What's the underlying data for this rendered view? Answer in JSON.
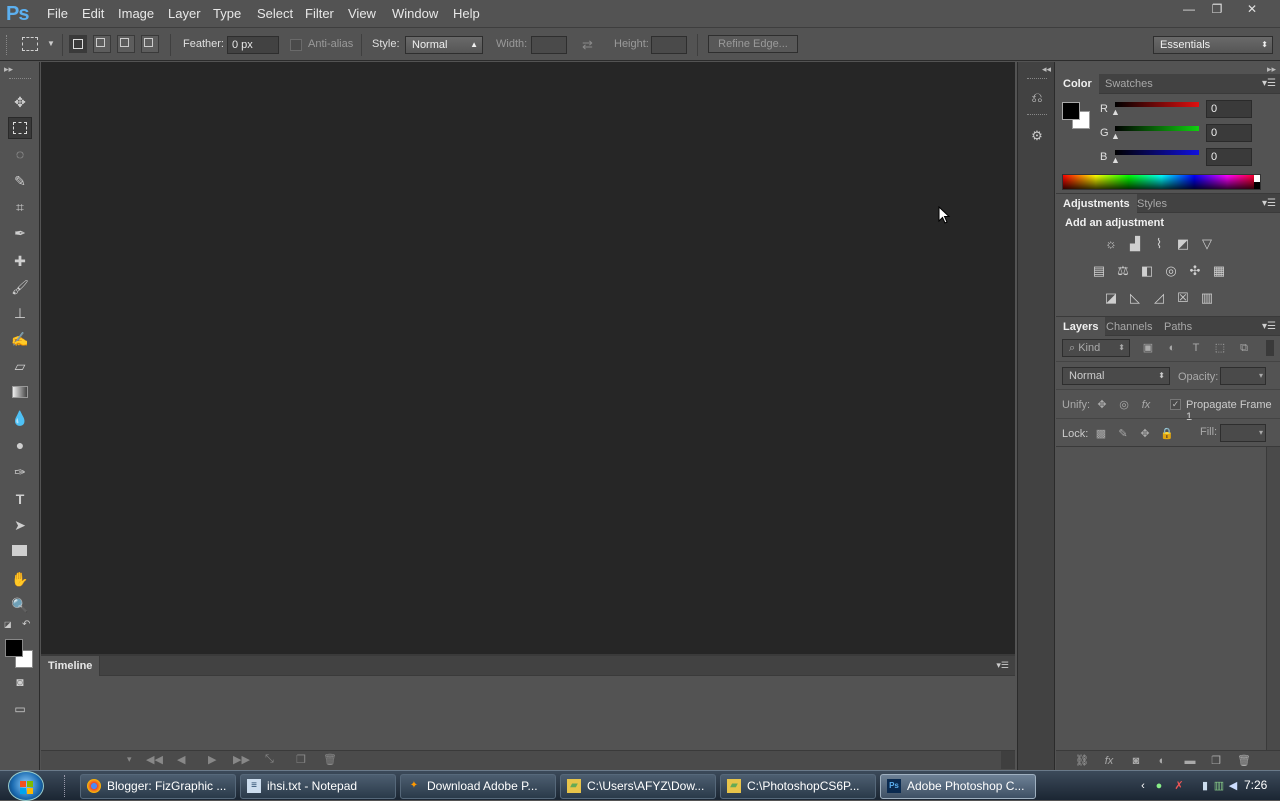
{
  "app": {
    "logo": "Ps"
  },
  "menubar": {
    "items": [
      "File",
      "Edit",
      "Image",
      "Layer",
      "Type",
      "Select",
      "Filter",
      "View",
      "Window",
      "Help"
    ]
  },
  "window_controls": {
    "minimize": "—",
    "restore": "❐",
    "close": "✕"
  },
  "options_bar": {
    "feather_label": "Feather:",
    "feather_value": "0 px",
    "antialias_label": "Anti-alias",
    "style_label": "Style:",
    "style_value": "Normal",
    "width_label": "Width:",
    "height_label": "Height:",
    "refine_edge_label": "Refine Edge...",
    "workspace_value": "Essentials"
  },
  "timeline": {
    "tab_label": "Timeline"
  },
  "color_panel": {
    "tabs": [
      "Color",
      "Swatches"
    ],
    "channels": [
      {
        "label": "R",
        "value": "0",
        "color": "#d01010"
      },
      {
        "label": "G",
        "value": "0",
        "color": "#10c010"
      },
      {
        "label": "B",
        "value": "0",
        "color": "#1010d0"
      }
    ]
  },
  "adjustments_panel": {
    "tabs": [
      "Adjustments",
      "Styles"
    ],
    "heading": "Add an adjustment"
  },
  "layers_panel": {
    "tabs": [
      "Layers",
      "Channels",
      "Paths"
    ],
    "kind_value": "Kind",
    "blend_mode_value": "Normal",
    "opacity_label": "Opacity:",
    "unify_label": "Unify:",
    "propagate_label": "Propagate Frame 1",
    "lock_label": "Lock:",
    "fill_label": "Fill:"
  },
  "taskbar": {
    "tasks": [
      {
        "label": "Blogger: FizGraphic ...",
        "icon": "chrome-icon"
      },
      {
        "label": "ihsi.txt - Notepad",
        "icon": "notepad-icon"
      },
      {
        "label": "Download Adobe P...",
        "icon": "browser-icon"
      },
      {
        "label": "C:\\Users\\AFYZ\\Dow...",
        "icon": "folder-icon"
      },
      {
        "label": "C:\\PhotoshopCS6P...",
        "icon": "folder-icon"
      },
      {
        "label": "Adobe Photoshop C...",
        "icon": "photoshop-icon"
      }
    ],
    "clock": "7:26"
  }
}
